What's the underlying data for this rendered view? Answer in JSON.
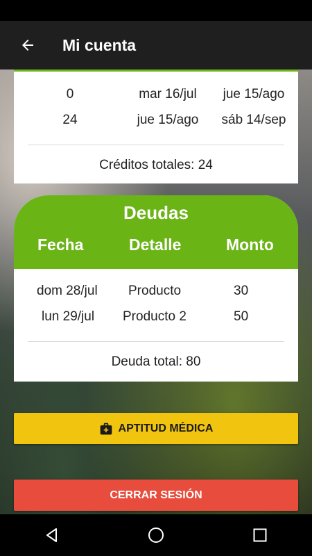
{
  "header": {
    "title": "Mi cuenta"
  },
  "credits": {
    "rows": [
      {
        "amount": "0",
        "start": "mar 16/jul",
        "end": "jue 15/ago"
      },
      {
        "amount": "24",
        "start": "jue 15/ago",
        "end": "sáb 14/sep"
      }
    ],
    "total": "Créditos totales: 24"
  },
  "debts": {
    "title": "Deudas",
    "columns": {
      "date": "Fecha",
      "detail": "Detalle",
      "amount": "Monto"
    },
    "rows": [
      {
        "date": "dom 28/jul",
        "detail": "Producto",
        "amount": "30"
      },
      {
        "date": "lun 29/jul",
        "detail": "Producto 2",
        "amount": "50"
      }
    ],
    "total": "Deuda total: 80"
  },
  "buttons": {
    "aptitud": "APTITUD MÉDICA",
    "logout": "CERRAR SESIÓN"
  },
  "colors": {
    "accent_green": "#6ab416",
    "aptitud_yellow": "#f1c40f",
    "logout_red": "#e74c3c"
  }
}
